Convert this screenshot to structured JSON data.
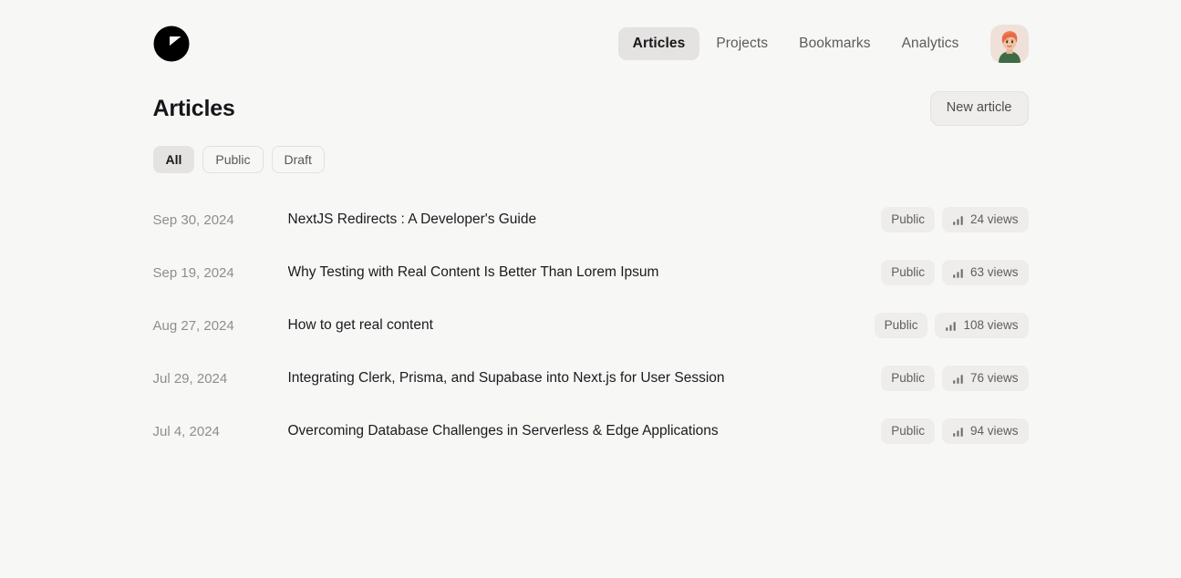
{
  "app": {
    "background_color": "#f7f7f6",
    "logo_name": "brand-logo"
  },
  "header": {
    "nav": [
      {
        "label": "Articles",
        "active": true
      },
      {
        "label": "Projects",
        "active": false
      },
      {
        "label": "Bookmarks",
        "active": false
      },
      {
        "label": "Analytics",
        "active": false
      }
    ],
    "avatar_alt": "user-avatar"
  },
  "main": {
    "title": "Articles",
    "new_article_label": "New article",
    "filters": [
      {
        "label": "All",
        "active": true
      },
      {
        "label": "Public",
        "active": false
      },
      {
        "label": "Draft",
        "active": false
      }
    ],
    "articles": [
      {
        "date": "Sep 30, 2024",
        "title": "NextJS Redirects : A Developer's Guide",
        "status": "Public",
        "views": "24 views"
      },
      {
        "date": "Sep 19, 2024",
        "title": "Why Testing with Real Content Is Better Than Lorem Ipsum",
        "status": "Public",
        "views": "63 views"
      },
      {
        "date": "Aug 27, 2024",
        "title": "How to get real content",
        "status": "Public",
        "views": "108 views"
      },
      {
        "date": "Jul 29, 2024",
        "title": "Integrating Clerk, Prisma, and Supabase into Next.js for User Session",
        "status": "Public",
        "views": "76 views"
      },
      {
        "date": "Jul 4, 2024",
        "title": "Overcoming Database Challenges in Serverless & Edge Applications",
        "status": "Public",
        "views": "94 views"
      }
    ]
  },
  "colors": {
    "background": "#f7f7f6",
    "active_pill": "#e4e3e1",
    "badge": "#eeedeb",
    "text_primary": "#1b1b1f",
    "text_muted": "#8e8e8e",
    "logo": "#000000"
  }
}
